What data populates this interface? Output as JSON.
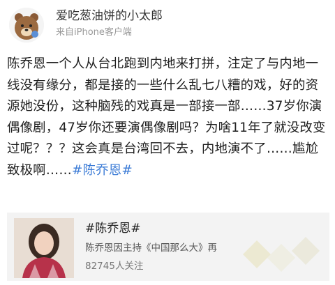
{
  "post": {
    "username": "爱吃葱油饼的小太郎",
    "source": "来自iPhone客户端",
    "body_text": "陈乔恩一个人从台北跑到内地来打拼，注定了与内地一线没有缘分，都是接的一些什么乱七八糟的戏，好的资源她没份，这种脑残的戏真是一部接一部……37岁你演偶像剧，47岁你还要演偶像剧吗？为啥11年了就没改变过呢？？？这会真是台湾回不去，内地演不了……尴尬致极啊……",
    "hashtag": "#陈乔恩#"
  },
  "topic_card": {
    "title": "#陈乔恩#",
    "description": "陈乔恩因主持《中国那么大》再",
    "followers": "82745人关注"
  },
  "colors": {
    "hashtag": "#3b7bd6",
    "card_background": "#f3f3f3"
  }
}
